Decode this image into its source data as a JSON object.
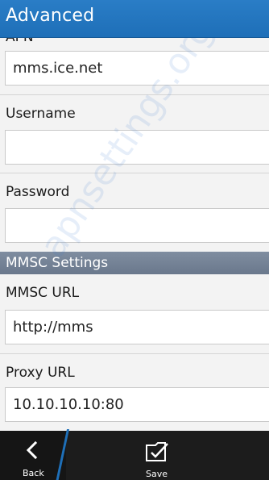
{
  "header": {
    "title": "Advanced"
  },
  "fields": {
    "apn": {
      "label": "APN",
      "value": "mms.ice.net"
    },
    "username": {
      "label": "Username",
      "value": ""
    },
    "password": {
      "label": "Password",
      "value": ""
    },
    "mmsc_url": {
      "label": "MMSC URL",
      "value": "http://mms"
    },
    "proxy_url": {
      "label": "Proxy URL",
      "value": "10.10.10.10:80"
    }
  },
  "sections": {
    "mmsc": "MMSC Settings"
  },
  "watermark": "apnsettings.org",
  "toolbar": {
    "back_label": "Back",
    "save_label": "Save"
  },
  "colors": {
    "header": "#1e6fb8",
    "section": "#72809a",
    "toolbar": "#1c1c1c"
  }
}
